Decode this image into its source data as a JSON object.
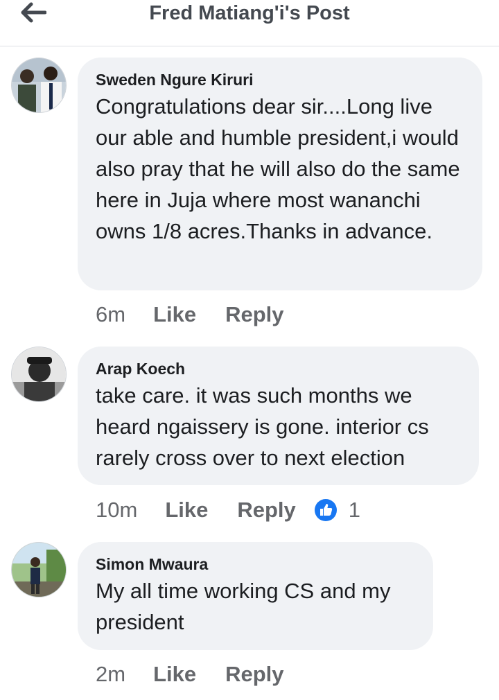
{
  "header": {
    "title": "Fred Matiang'i's Post",
    "back_icon": "arrow-left-icon"
  },
  "comments": [
    {
      "author": "Sweden Ngure Kiruri",
      "text": "Congratulations dear sir....Long live our able and humble  president,i would also pray that he will also do the same here in Juja where most wananchi owns 1/8 acres.Thanks in advance.",
      "time": "6m",
      "like_label": "Like",
      "reply_label": "Reply"
    },
    {
      "author": "Arap Koech",
      "text": "take care. it was such months we heard ngaissery is gone. interior cs rarely cross over to next election",
      "time": "10m",
      "like_label": "Like",
      "reply_label": "Reply",
      "reaction_icon": "thumbs-up-icon",
      "reaction_count": "1"
    },
    {
      "author": "Simon Mwaura",
      "text": "My all time working CS and my president",
      "time": "2m",
      "like_label": "Like",
      "reply_label": "Reply"
    }
  ],
  "colors": {
    "bubble": "#f0f2f5",
    "meta_text": "#65676b",
    "reaction_blue": "#1877f2"
  }
}
